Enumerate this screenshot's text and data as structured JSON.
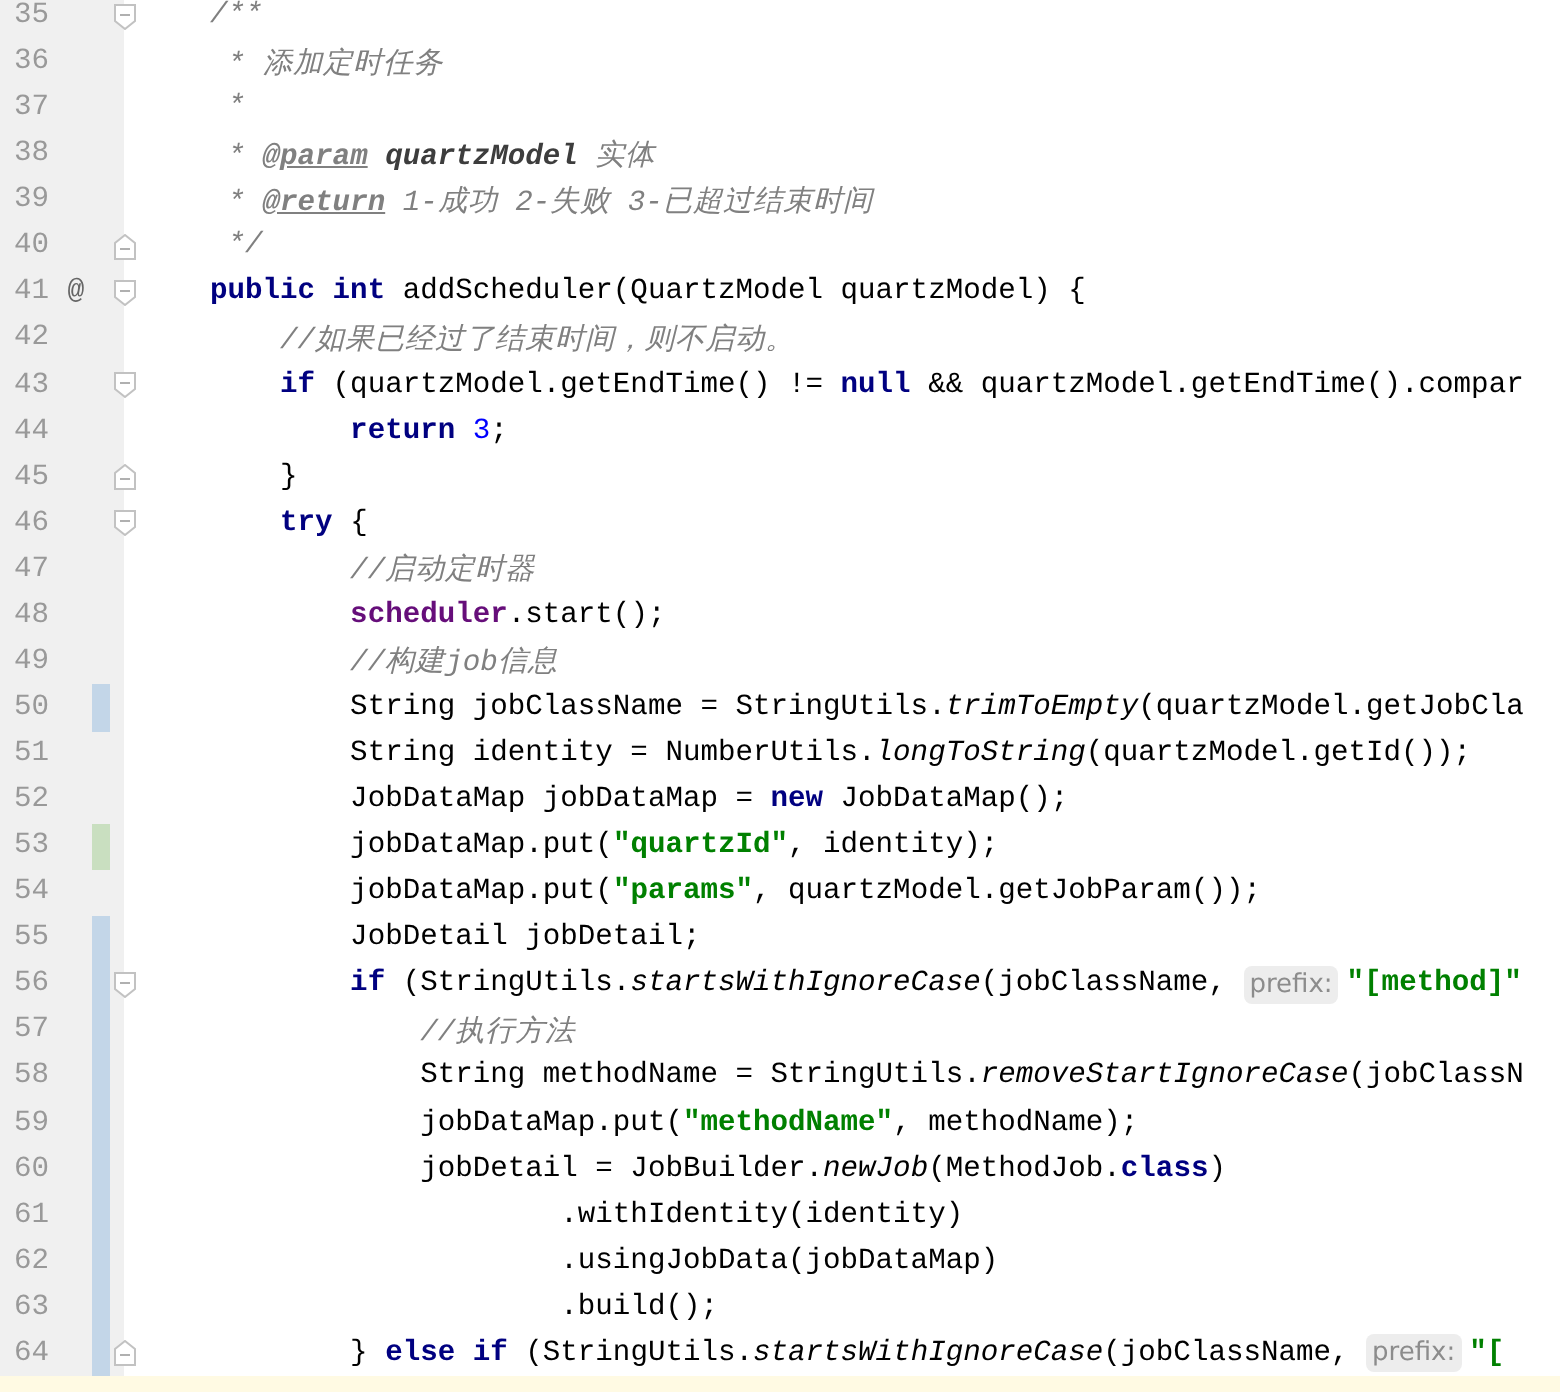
{
  "editor": {
    "lines": [
      {
        "number": "35",
        "marks": [
          {
            "kind": "fold-start"
          }
        ],
        "tokens": [
          {
            "t": "/**",
            "kind": "comment"
          }
        ]
      },
      {
        "number": "36",
        "tokens": [
          {
            "t": " * 添加定时任务",
            "kind": "comment"
          }
        ]
      },
      {
        "number": "37",
        "tokens": [
          {
            "t": " *",
            "kind": "comment"
          }
        ]
      },
      {
        "number": "38",
        "tokens": [
          {
            "t": " * ",
            "kind": "comment"
          },
          {
            "t": "@param",
            "kind": "doc-tag"
          },
          {
            "t": " quartzModel",
            "kind": "doc-param"
          },
          {
            "t": " 实体",
            "kind": "comment"
          }
        ]
      },
      {
        "number": "39",
        "tokens": [
          {
            "t": " * ",
            "kind": "comment"
          },
          {
            "t": "@return",
            "kind": "doc-tag"
          },
          {
            "t": " 1-成功 2-失败 3-已超过结束时间",
            "kind": "comment"
          }
        ]
      },
      {
        "number": "40",
        "marks": [
          {
            "kind": "fold-end"
          }
        ],
        "tokens": [
          {
            "t": " */",
            "kind": "comment"
          }
        ]
      },
      {
        "number": "41",
        "marker": "@",
        "marks": [
          {
            "kind": "fold-start"
          }
        ],
        "tokens": [
          {
            "t": "public int",
            "kind": "keyword"
          },
          {
            "t": " addScheduler(QuartzModel quartzModel) {",
            "kind": "plain"
          }
        ]
      },
      {
        "number": "42",
        "tokens": [
          {
            "t": "    //如果已经过了结束时间，则不启动。",
            "kind": "comment"
          }
        ]
      },
      {
        "number": "43",
        "marks": [
          {
            "kind": "fold-start"
          }
        ],
        "tokens": [
          {
            "t": "    if",
            "kind": "keyword"
          },
          {
            "t": " (quartzModel.getEndTime() != ",
            "kind": "plain"
          },
          {
            "t": "null",
            "kind": "keyword"
          },
          {
            "t": " && quartzModel.getEndTime().compar",
            "kind": "plain"
          }
        ]
      },
      {
        "number": "44",
        "tokens": [
          {
            "t": "        return",
            "kind": "keyword"
          },
          {
            "t": " 3",
            "kind": "number"
          },
          {
            "t": ";",
            "kind": "plain"
          }
        ]
      },
      {
        "number": "45",
        "marks": [
          {
            "kind": "fold-end"
          }
        ],
        "tokens": [
          {
            "t": "    }",
            "kind": "plain"
          }
        ]
      },
      {
        "number": "46",
        "marks": [
          {
            "kind": "fold-start"
          }
        ],
        "tokens": [
          {
            "t": "    try",
            "kind": "keyword"
          },
          {
            "t": " {",
            "kind": "plain"
          }
        ]
      },
      {
        "number": "47",
        "tokens": [
          {
            "t": "        //启动定时器",
            "kind": "comment"
          }
        ]
      },
      {
        "number": "48",
        "tokens": [
          {
            "t": "        scheduler",
            "kind": "field"
          },
          {
            "t": ".start();",
            "kind": "plain"
          }
        ]
      },
      {
        "number": "49",
        "tokens": [
          {
            "t": "        //构建job信息",
            "kind": "comment"
          }
        ]
      },
      {
        "number": "50",
        "marks": [
          {
            "kind": "modified"
          }
        ],
        "tokens": [
          {
            "t": "        String jobClassName = StringUtils.",
            "kind": "plain"
          },
          {
            "t": "trimToEmpty",
            "kind": "static-call"
          },
          {
            "t": "(quartzModel.getJobCla",
            "kind": "plain"
          }
        ]
      },
      {
        "number": "51",
        "tokens": [
          {
            "t": "        String identity = NumberUtils.",
            "kind": "plain"
          },
          {
            "t": "longToString",
            "kind": "static-call"
          },
          {
            "t": "(quartzModel.getId());",
            "kind": "plain"
          }
        ]
      },
      {
        "number": "52",
        "tokens": [
          {
            "t": "        JobDataMap jobDataMap = ",
            "kind": "plain"
          },
          {
            "t": "new",
            "kind": "keyword"
          },
          {
            "t": " JobDataMap();",
            "kind": "plain"
          }
        ]
      },
      {
        "number": "53",
        "marks": [
          {
            "kind": "added"
          }
        ],
        "tokens": [
          {
            "t": "        jobDataMap.put(",
            "kind": "plain"
          },
          {
            "t": "\"quartzId\"",
            "kind": "string"
          },
          {
            "t": ", identity);",
            "kind": "plain"
          }
        ]
      },
      {
        "number": "54",
        "tokens": [
          {
            "t": "        jobDataMap.put(",
            "kind": "plain"
          },
          {
            "t": "\"params\"",
            "kind": "string"
          },
          {
            "t": ", quartzModel.getJobParam());",
            "kind": "plain"
          }
        ]
      },
      {
        "number": "55",
        "marks": [
          {
            "kind": "modified"
          }
        ],
        "tokens": [
          {
            "t": "        JobDetail jobDetail;",
            "kind": "plain"
          }
        ]
      },
      {
        "number": "56",
        "marks": [
          {
            "kind": "modified"
          },
          {
            "kind": "fold-start"
          }
        ],
        "tokens": [
          {
            "t": "        if",
            "kind": "keyword"
          },
          {
            "t": " (StringUtils.",
            "kind": "plain"
          },
          {
            "t": "startsWithIgnoreCase",
            "kind": "static-call"
          },
          {
            "t": "(jobClassName, ",
            "kind": "plain"
          },
          {
            "t": "prefix:",
            "kind": "hint"
          },
          {
            "t": "\"[method]\"",
            "kind": "string"
          }
        ]
      },
      {
        "number": "57",
        "marks": [
          {
            "kind": "modified"
          }
        ],
        "tokens": [
          {
            "t": "            //执行方法",
            "kind": "comment"
          }
        ]
      },
      {
        "number": "58",
        "marks": [
          {
            "kind": "modified"
          }
        ],
        "tokens": [
          {
            "t": "            String methodName = StringUtils.",
            "kind": "plain"
          },
          {
            "t": "removeStartIgnoreCase",
            "kind": "static-call"
          },
          {
            "t": "(jobClassN",
            "kind": "plain"
          }
        ]
      },
      {
        "number": "59",
        "marks": [
          {
            "kind": "modified"
          }
        ],
        "tokens": [
          {
            "t": "            jobDataMap.put(",
            "kind": "plain"
          },
          {
            "t": "\"methodName\"",
            "kind": "string"
          },
          {
            "t": ", methodName);",
            "kind": "plain"
          }
        ]
      },
      {
        "number": "60",
        "marks": [
          {
            "kind": "modified"
          }
        ],
        "tokens": [
          {
            "t": "            jobDetail = JobBuilder.",
            "kind": "plain"
          },
          {
            "t": "newJob",
            "kind": "static-call"
          },
          {
            "t": "(MethodJob.",
            "kind": "plain"
          },
          {
            "t": "class",
            "kind": "keyword"
          },
          {
            "t": ")",
            "kind": "plain"
          }
        ]
      },
      {
        "number": "61",
        "marks": [
          {
            "kind": "modified"
          }
        ],
        "tokens": [
          {
            "t": "                    .withIdentity(identity)",
            "kind": "plain"
          }
        ]
      },
      {
        "number": "62",
        "marks": [
          {
            "kind": "modified"
          }
        ],
        "tokens": [
          {
            "t": "                    .usingJobData(jobDataMap)",
            "kind": "plain"
          }
        ]
      },
      {
        "number": "63",
        "marks": [
          {
            "kind": "modified"
          }
        ],
        "tokens": [
          {
            "t": "                    .build();",
            "kind": "plain"
          }
        ]
      },
      {
        "number": "64",
        "marks": [
          {
            "kind": "modified"
          },
          {
            "kind": "fold-end"
          }
        ],
        "tokens": [
          {
            "t": "        } ",
            "kind": "plain"
          },
          {
            "t": "else if",
            "kind": "keyword"
          },
          {
            "t": " (StringUtils.",
            "kind": "plain"
          },
          {
            "t": "startsWithIgnoreCase",
            "kind": "static-call"
          },
          {
            "t": "(jobClassName, ",
            "kind": "plain"
          },
          {
            "t": "prefix:",
            "kind": "hint"
          },
          {
            "t": "\"[",
            "kind": "string"
          }
        ]
      }
    ]
  }
}
